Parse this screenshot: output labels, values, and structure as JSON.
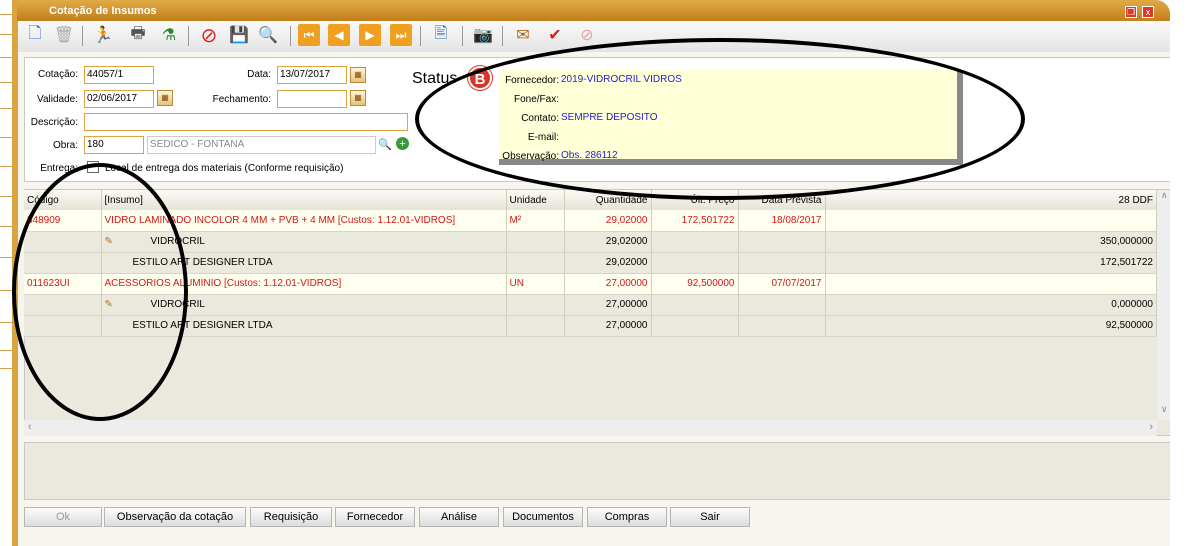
{
  "window": {
    "title": "Cotação de Insumos",
    "restore_icon": "restore-icon",
    "close_icon": "close-icon"
  },
  "toolbar": {
    "icons": [
      "new-document-icon",
      "trash-icon",
      "run-icon",
      "print-icon",
      "filter-add-icon",
      "cancel-icon",
      "save-icon",
      "search-icon",
      "first-icon",
      "previous-icon",
      "next-icon",
      "last-icon",
      "report-icon",
      "camera-icon",
      "approve-icon",
      "approve-check-icon",
      "reject-icon"
    ]
  },
  "form": {
    "cotacao_label": "Cotação:",
    "cotacao_value": "44057/1",
    "data_label": "Data:",
    "data_value": "13/07/2017",
    "validade_label": "Validade:",
    "validade_value": "02/06/2017",
    "fechamento_label": "Fechamento:",
    "fechamento_value": "",
    "descricao_label": "Descrição:",
    "descricao_value": "",
    "obra_label": "Obra:",
    "obra_code": "180",
    "obra_name": "SEDICO - FONTANA",
    "entrega_label": "Entrega:",
    "entrega_text": "Local de entrega dos materiais (Conforme requisição)",
    "status_label": "Status",
    "status_value": "B"
  },
  "supplier": {
    "fornecedor_label": "Fornecedor:",
    "fornecedor_value": "2019-VIDROCRIL VIDROS",
    "fone_label": "Fone/Fax:",
    "fone_value": "",
    "contato_label": "Contato:",
    "contato_value": "SEMPRE DEPOSITO",
    "email_label": "E-mail:",
    "email_value": "",
    "obs_label": "Observação:",
    "obs_value": "Obs. 286112"
  },
  "grid": {
    "headers": [
      "Código",
      "[Insumo]",
      "Unidade",
      "Quantidade",
      "Últ. Preço",
      "Data Prevista",
      "28 DDF"
    ],
    "rows": [
      {
        "type": "main",
        "codigo": "848909",
        "insumo": "VIDRO LAMINADO INCOLOR 4 MM + PVB + 4 MM [Custos: 1.12.01-VIDROS]",
        "unidade": "M²",
        "quantidade": "29,02000",
        "preco": "172,501722",
        "data": "18/08/2017",
        "ddf": ""
      },
      {
        "type": "sub",
        "icon": true,
        "insumo": "VIDROCRIL",
        "quantidade": "29,02000",
        "ddf": "350,000000"
      },
      {
        "type": "sub",
        "icon": false,
        "insumo": "ESTILO ART DESIGNER LTDA",
        "quantidade": "29,02000",
        "ddf": "172,501722"
      },
      {
        "type": "main",
        "codigo": "011623UI",
        "insumo": "ACESSORIOS ALUMINIO [Custos: 1.12.01-VIDROS]",
        "unidade": "UN",
        "quantidade": "27,00000",
        "preco": "92,500000",
        "data": "07/07/2017",
        "ddf": ""
      },
      {
        "type": "sub",
        "icon": true,
        "insumo": "VIDROCRIL",
        "quantidade": "27,00000",
        "ddf": "0,000000"
      },
      {
        "type": "sub",
        "icon": false,
        "insumo": "ESTILO ART DESIGNER LTDA",
        "quantidade": "27,00000",
        "ddf": "92,500000"
      }
    ]
  },
  "buttons": {
    "ok": "Ok",
    "observacao": "Observação da cotação",
    "requisicao": "Requisição",
    "fornecedor": "Fornecedor",
    "analise": "Análise",
    "documentos": "Documentos",
    "compras": "Compras",
    "sair": "Sair"
  }
}
